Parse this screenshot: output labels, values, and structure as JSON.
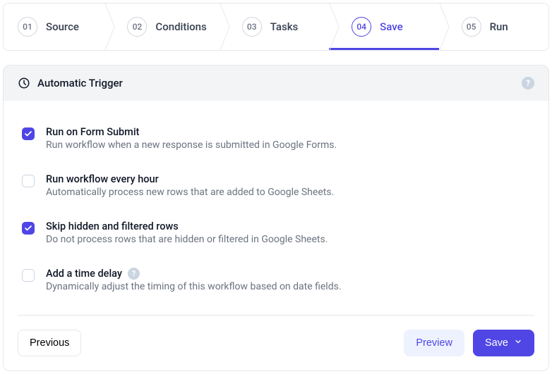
{
  "steps": [
    {
      "num": "01",
      "label": "Source"
    },
    {
      "num": "02",
      "label": "Conditions"
    },
    {
      "num": "03",
      "label": "Tasks"
    },
    {
      "num": "04",
      "label": "Save"
    },
    {
      "num": "05",
      "label": "Run"
    }
  ],
  "active_step": "Save",
  "card": {
    "title": "Automatic Trigger"
  },
  "options": [
    {
      "checked": true,
      "title": "Run on Form Submit",
      "desc": "Run workflow when a new response is submitted in Google Forms.",
      "help": false
    },
    {
      "checked": false,
      "title": "Run workflow every hour",
      "desc": "Automatically process new rows that are added to Google Sheets.",
      "help": false
    },
    {
      "checked": true,
      "title": "Skip hidden and filtered rows",
      "desc": "Do not process rows that are hidden or filtered in Google Sheets.",
      "help": false
    },
    {
      "checked": false,
      "title": "Add a time delay",
      "desc": "Dynamically adjust the timing of this workflow based on date fields.",
      "help": true
    }
  ],
  "footer": {
    "previous": "Previous",
    "preview": "Preview",
    "save": "Save"
  },
  "colors": {
    "accent": "#4f46e5"
  }
}
